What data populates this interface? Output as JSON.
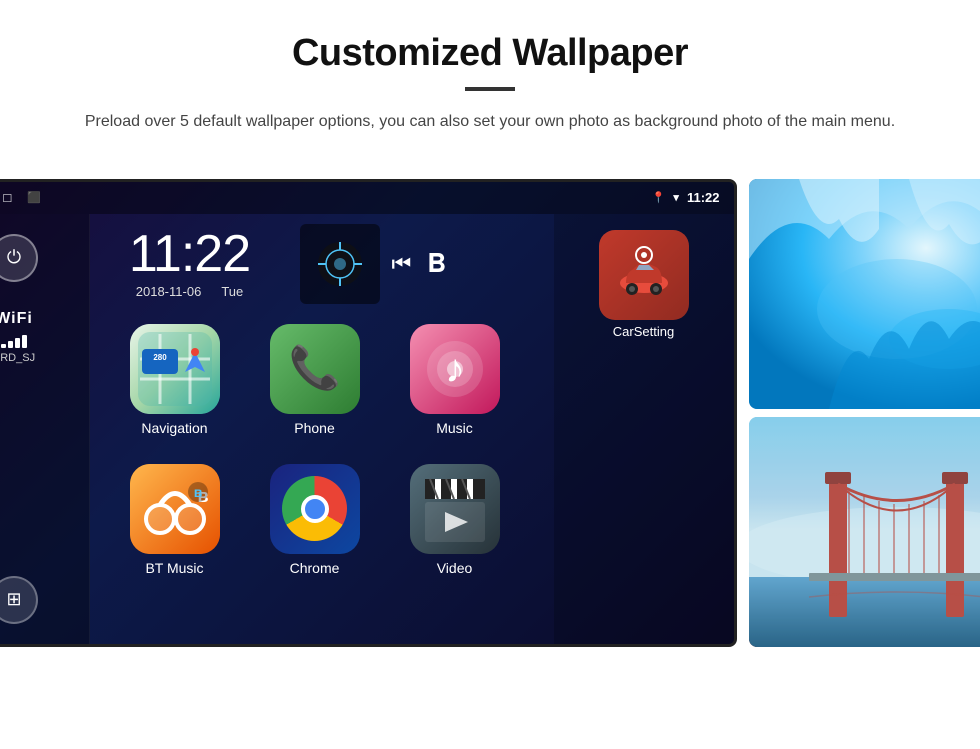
{
  "header": {
    "title": "Customized Wallpaper",
    "subtitle": "Preload over 5 default wallpaper options, you can also set your own photo as background photo of the main menu."
  },
  "device": {
    "status_bar": {
      "back_icon": "◁",
      "home_icon": "○",
      "recents_icon": "□",
      "screenshot_icon": "⬛",
      "location_icon": "▾",
      "wifi_icon": "▾",
      "time": "11:22"
    },
    "clock": {
      "time": "11:22",
      "date": "2018-11-06",
      "day": "Tue"
    },
    "wifi": {
      "label": "WiFi",
      "ssid": "SRD_SJ"
    },
    "apps": [
      {
        "id": "navigation",
        "label": "Navigation",
        "type": "nav"
      },
      {
        "id": "phone",
        "label": "Phone",
        "type": "phone"
      },
      {
        "id": "music",
        "label": "Music",
        "type": "music"
      },
      {
        "id": "btmusic",
        "label": "BT Music",
        "type": "bt"
      },
      {
        "id": "chrome",
        "label": "Chrome",
        "type": "chrome"
      },
      {
        "id": "video",
        "label": "Video",
        "type": "video"
      }
    ],
    "carsetting_label": "CarSetting"
  }
}
